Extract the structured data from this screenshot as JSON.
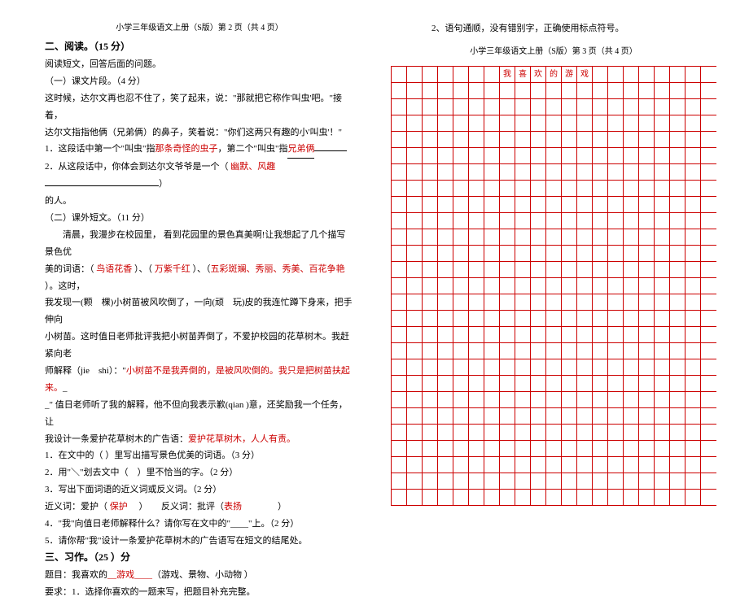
{
  "colRight": {
    "topline": "2、语句通顺，没有错别字，正确使用标点符号。",
    "header": "小学三年级语文上册（S版）第 3 页（共 4 页）",
    "gridTitle": [
      "我",
      "喜",
      "欢",
      "的",
      "游",
      "戏"
    ]
  },
  "colLeft": {
    "header": "小学三年级语文上册（S版）第 2 页（共 4 页）",
    "title": "二、阅读。（15 分）",
    "l1": "阅读短文，回答后面的问题。",
    "l2": "（一）课文片段。（4 分）",
    "l3": "这时候，达尔文再也忍不住了，笑了起来，说：\"那就把它称作'叫虫'吧。\"接着，",
    "l4": "达尔文指指他俩（兄弟俩）的鼻子，笑着说：\"你们这两只有趣的小'叫虫'！\"",
    "l5a": "1．这段话中第一个\"叫虫\"指",
    "l5red1": "那条奇怪的虫子",
    "l5b": "，第二个\"叫虫\"指",
    "l5red2": "兄弟俩",
    "l6a": "2．从这段话中，你体会到达尔文爷爷是一个（",
    "l6red": " 幽默、风趣 ",
    "l6b": "）",
    "l7": "的人。",
    "l8": "（二）课外短文。（11 分）",
    "l9": "　　清晨，我漫步在校园里， 看到花园里的景色真美啊!让我想起了几个描写景色优",
    "l10a": "美的词语：（",
    "l10red1": " 鸟语花香 ",
    "l10b": "）、（",
    "l10red2": " 万紫千红 ",
    "l10c": "）、（",
    "l10red3": "五彩斑斓、秀丽、秀美、百花争艳 ",
    "l10d": "）。这时，",
    "l11": "我发现一(颗　棵)小树苗被风吹倒了，一向(顽　玩)皮的我连忙蹲下身来，把手伸向",
    "l12": "小树苗。这时值日老师批评我把小树苗弄倒了，不爱护校园的花草树木。我赶紧向老",
    "l13a": "师解释（jie　shi）：\"",
    "l13red": "小树苗不是我弄倒的，是被风吹倒的。我只是把树苗扶起来。",
    "l13b": "_",
    "l14": "_\" 值日老师听了我的解释，他不但向我表示歉(qian )意，还奖励我一个任务，让",
    "l15a": "我设计一条爱护花草树木的广告语：",
    "l15red": "爱护花草树木，人人有责。",
    "l16": "1．在文中的（ ）里写出描写景色优美的词语。（3 分）",
    "l17": "2．用\"＼\"划去文中（　）里不恰当的字。（2 分）",
    "l18": "3．写出下面词语的近义词或反义词。（2 分）",
    "l19a": "近义词：爱护（",
    "l19red1": " 保护 ",
    "l19b": "　）　　反义词：批评（",
    "l19red2": "表扬",
    "l19c": "　　　　）",
    "l20": "4．\"我\"向值日老师解释什么？请你写在文中的\"____\"上。（2 分）",
    "l21": "5．请你帮\"我\"设计一条爱护花草树木的广告语写在短文的结尾处。",
    "title3": "三、习作。（25 ）分",
    "l22a": "题目：我喜欢的",
    "l22red": "__游戏____",
    "l22b": "（游戏、景物、小动物 ）",
    "l23": "要求：1．选择你喜欢的一题来写，把题目补充完整。"
  }
}
